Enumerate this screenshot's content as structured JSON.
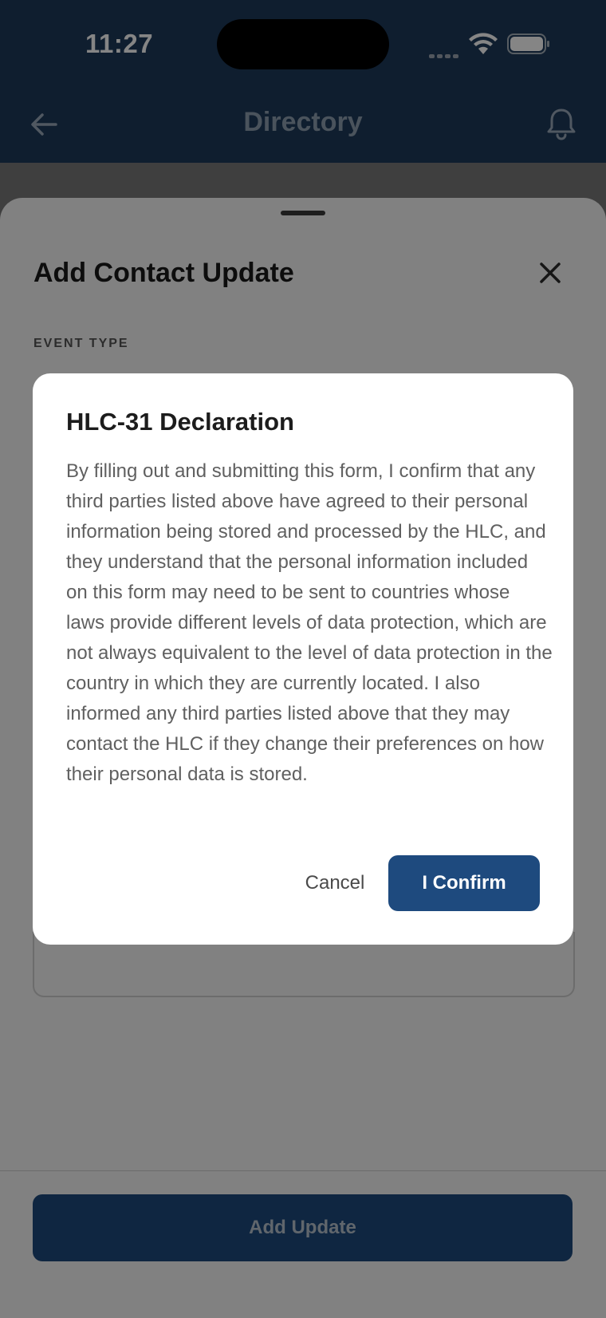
{
  "status_bar": {
    "time": "11:27"
  },
  "header": {
    "title": "Directory",
    "back_icon": "arrow-left-icon",
    "bell_icon": "bell-icon"
  },
  "sheet": {
    "title": "Add Contact Update",
    "event_type_label": "EVENT TYPE",
    "add_update_label": "Add Update"
  },
  "dialog": {
    "title": "HLC-31 Declaration",
    "body": "By filling out and submitting this form, I confirm that any third parties listed above have agreed to their personal information being stored and processed by the HLC, and they understand that the personal information included on this form may need to be sent to countries whose laws provide different levels of data protection, which are not always equivalent to the level of data protection in the country in which they are currently located. I also informed any third parties listed above that they may contact the HLC if they change their preferences on how their personal data is stored.",
    "cancel_label": "Cancel",
    "confirm_label": "I Confirm"
  },
  "colors": {
    "header_bg": "#1d3a5a",
    "primary_button": "#1e4a7e",
    "dialog_bg": "#ffffff"
  }
}
